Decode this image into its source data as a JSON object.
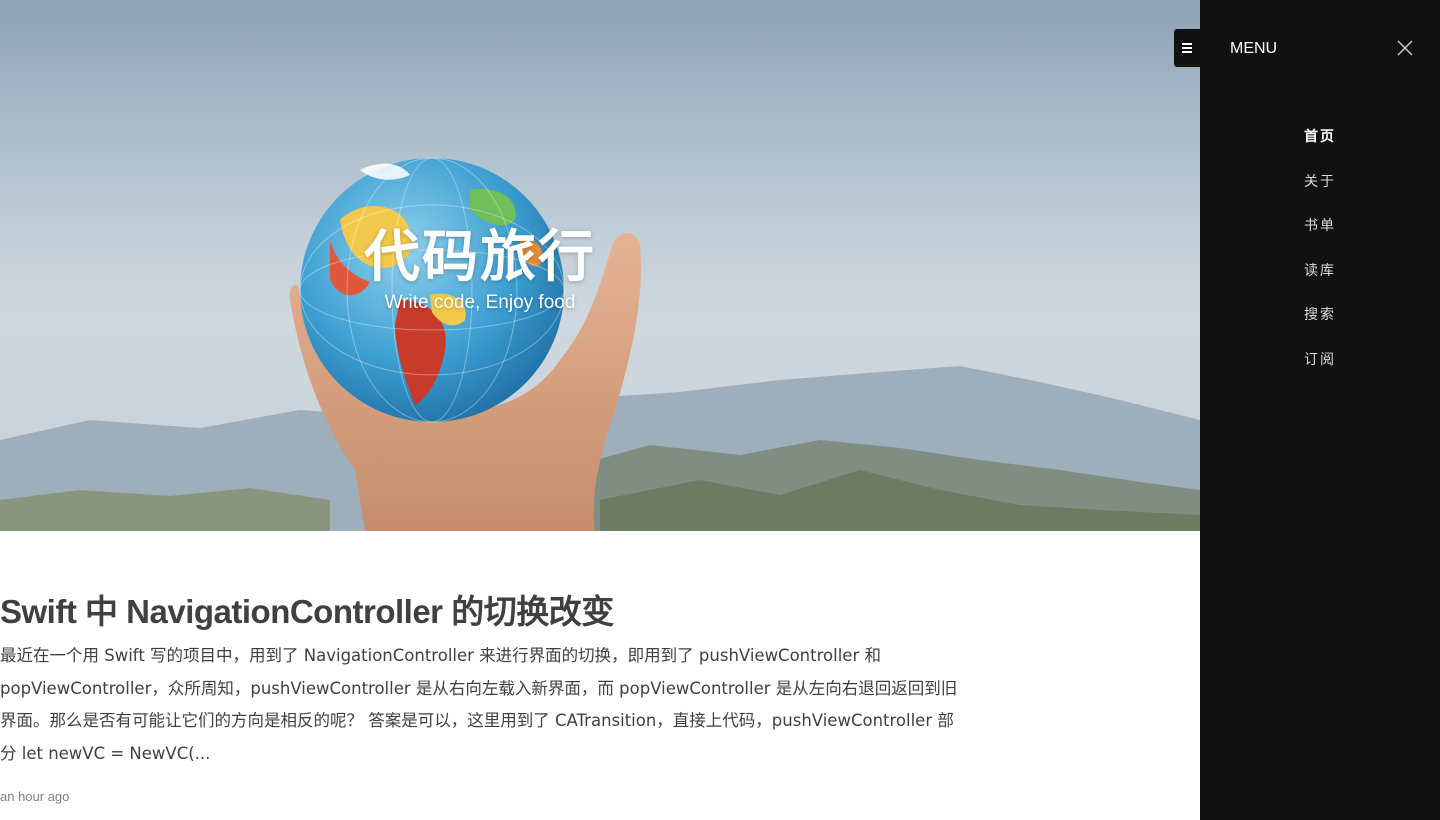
{
  "hero": {
    "title": "代码旅行",
    "subtitle": "Write code, Enjoy food"
  },
  "post": {
    "title": "Swift 中 NavigationController 的切换改变",
    "excerpt": "最近在一个用 Swift 写的项目中，用到了 NavigationController 来进行界面的切换，即用到了 pushViewController 和 popViewController，众所周知，pushViewController 是从右向左载入新界面，而 popViewController 是从左向右退回返回到旧界面。那么是否有可能让它们的方向是相反的呢？ 答案是可以，这里用到了 CATransition，直接上代码，pushViewController 部分 let newVC = NewVC(...",
    "meta": "an hour ago"
  },
  "sidebar": {
    "title": "MENU",
    "items": [
      {
        "label": "首页",
        "active": true
      },
      {
        "label": "关于",
        "active": false
      },
      {
        "label": "书单",
        "active": false
      },
      {
        "label": "读库",
        "active": false
      },
      {
        "label": "搜索",
        "active": false
      },
      {
        "label": "订阅",
        "active": false
      }
    ]
  },
  "icons": {
    "toggle": "hamburger-icon",
    "close": "close-icon"
  },
  "colors": {
    "sidebar_bg": "#111111",
    "text": "#404040",
    "meta": "#808080"
  }
}
